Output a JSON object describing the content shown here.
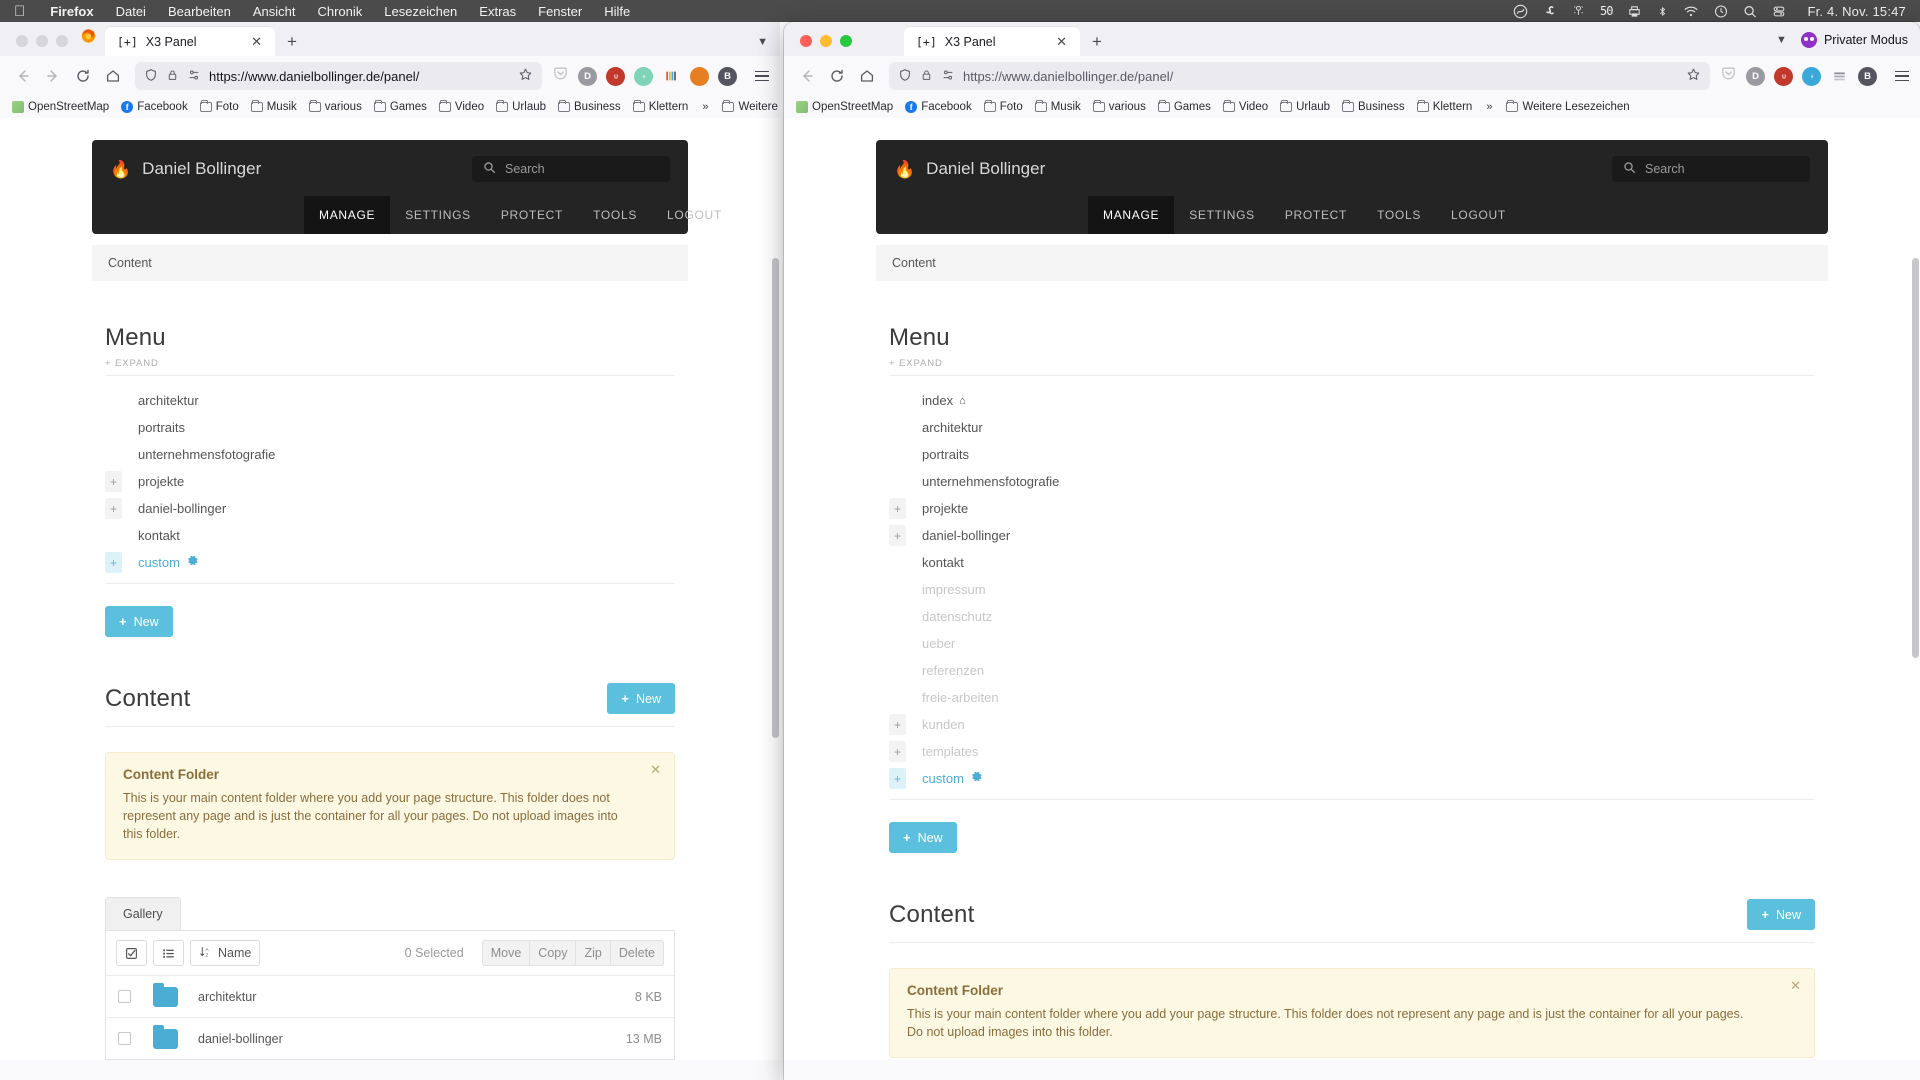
{
  "os": {
    "menubar": {
      "apple_icon": "apple-icon",
      "items": [
        "Firefox",
        "Datei",
        "Bearbeiten",
        "Ansicht",
        "Chronik",
        "Lesezeichen",
        "Extras",
        "Fenster",
        "Hilfe"
      ],
      "tray_icons": [
        "cloud-sync-icon",
        "shortcuts-icon",
        "airdrop-icon",
        "speed-50-icon",
        "printer-icon",
        "bluetooth-icon",
        "wifi-icon",
        "timemachine-icon",
        "search-icon",
        "controlcenter-icon"
      ],
      "speed_badge": "50",
      "clock": "Fr. 4. Nov.  15:47"
    }
  },
  "windows": {
    "left": {
      "tab": {
        "favicon_text": "[+]",
        "title": "X3 Panel",
        "close_icon": "close-icon"
      },
      "newtab_icon": "plus-icon",
      "nav": {
        "back_icon": "back-arrow-icon",
        "forward_icon": "forward-arrow-icon",
        "reload_icon": "reload-icon",
        "home_icon": "home-icon",
        "shield_icon": "shield-icon",
        "lock_icon": "lock-icon",
        "permissions_icon": "permissions-icon",
        "url": "https://www.danielbollinger.de/panel/",
        "bookmark_star_icon": "star-icon",
        "menu_icon": "hamburger-menu-icon",
        "extensions": [
          "pocket-icon",
          "ddg-icon",
          "ublock-icon",
          "extension-green-icon",
          "extension-stripes-icon",
          "extension-orange-icon",
          "extension-darkgray-icon"
        ]
      },
      "bookmarks": {
        "items": [
          "OpenStreetMap",
          "Facebook",
          "Foto",
          "Musik",
          "various",
          "Games",
          "Video",
          "Urlaub",
          "Business",
          "Klettern"
        ],
        "overflow_icon": "chevron-double-right-icon",
        "more_label": "Weitere Lesezeichen"
      }
    },
    "right": {
      "tab": {
        "favicon_text": "[+]",
        "title": "X3 Panel",
        "close_icon": "close-icon"
      },
      "newtab_icon": "plus-icon",
      "list_all_tabs_icon": "chevron-down-icon",
      "private_mode_label": "Privater Modus",
      "private_mode_icon": "private-mask-icon",
      "nav": {
        "url": "https://www.danielbollinger.de/panel/",
        "extensions": [
          "pocket-icon",
          "ddg-icon",
          "ublock-icon",
          "extension-blue-icon",
          "extension-gray-icon",
          "extension-teal-icon"
        ]
      },
      "bookmarks": {
        "items": [
          "OpenStreetMap",
          "Facebook",
          "Foto",
          "Musik",
          "various",
          "Games",
          "Video",
          "Urlaub",
          "Business",
          "Klettern"
        ],
        "overflow_icon": "chevron-double-right-icon",
        "more_label": "Weitere Lesezeichen"
      }
    }
  },
  "panel": {
    "brand": "Daniel Bollinger",
    "brand_icon": "flame-logo-icon",
    "search_placeholder": "Search",
    "search_icon": "search-icon",
    "nav_items": [
      "MANAGE",
      "SETTINGS",
      "PROTECT",
      "TOOLS",
      "LOGOUT"
    ],
    "active_nav": "MANAGE",
    "breadcrumb": "Content",
    "menu_section": {
      "title": "Menu",
      "expand_label": "+ EXPAND",
      "new_button": "New",
      "new_icon": "plus-icon"
    },
    "content_section": {
      "title": "Content",
      "new_button": "New",
      "new_icon": "plus-icon"
    },
    "alert": {
      "title": "Content Folder",
      "body": "This is your main content folder where you add your page structure. This folder does not represent any page and is just the container for all your pages. Do not upload images into this folder.",
      "close_icon": "close-icon"
    },
    "gallery": {
      "tab_label": "Gallery",
      "select_all_icon": "checkbox-checked-icon",
      "list_view_icon": "list-view-icon",
      "sort_icon": "sort-az-icon",
      "sort_label": "Name",
      "selected_label": "0 Selected",
      "actions": [
        "Move",
        "Copy",
        "Zip",
        "Delete"
      ],
      "rows": [
        {
          "name": "architektur",
          "size": "8 KB",
          "icon": "folder-icon"
        },
        {
          "name": "daniel-bollinger",
          "size": "13 MB",
          "icon": "folder-icon"
        }
      ]
    },
    "tree_left": [
      {
        "label": "architektur",
        "toggle": false,
        "state": "normal"
      },
      {
        "label": "portraits",
        "toggle": false,
        "state": "normal"
      },
      {
        "label": "unternehmensfotografie",
        "toggle": false,
        "state": "normal"
      },
      {
        "label": "projekte",
        "toggle": true,
        "state": "normal"
      },
      {
        "label": "daniel-bollinger",
        "toggle": true,
        "state": "normal"
      },
      {
        "label": "kontakt",
        "toggle": false,
        "state": "normal"
      },
      {
        "label": "custom",
        "toggle": true,
        "state": "blue",
        "gear": "gear-icon"
      }
    ],
    "tree_right": [
      {
        "label": "index",
        "toggle": false,
        "state": "normal",
        "home": "home-icon"
      },
      {
        "label": "architektur",
        "toggle": false,
        "state": "normal"
      },
      {
        "label": "portraits",
        "toggle": false,
        "state": "normal"
      },
      {
        "label": "unternehmensfotografie",
        "toggle": false,
        "state": "normal"
      },
      {
        "label": "projekte",
        "toggle": true,
        "state": "normal"
      },
      {
        "label": "daniel-bollinger",
        "toggle": true,
        "state": "normal"
      },
      {
        "label": "kontakt",
        "toggle": false,
        "state": "normal"
      },
      {
        "label": "impressum",
        "toggle": false,
        "state": "dim"
      },
      {
        "label": "datenschutz",
        "toggle": false,
        "state": "dim"
      },
      {
        "label": "ueber",
        "toggle": false,
        "state": "dim"
      },
      {
        "label": "referenzen",
        "toggle": false,
        "state": "dim"
      },
      {
        "label": "freie-arbeiten",
        "toggle": false,
        "state": "dim"
      },
      {
        "label": "kunden",
        "toggle": true,
        "state": "dim"
      },
      {
        "label": "templates",
        "toggle": true,
        "state": "dim"
      },
      {
        "label": "custom",
        "toggle": true,
        "state": "blue",
        "gear": "gear-icon"
      }
    ]
  },
  "colors": {
    "accent": "#5bc0de",
    "panel_dark": "#242424",
    "alert_bg": "#fcf8e3",
    "alert_fg": "#8a6d3b"
  }
}
